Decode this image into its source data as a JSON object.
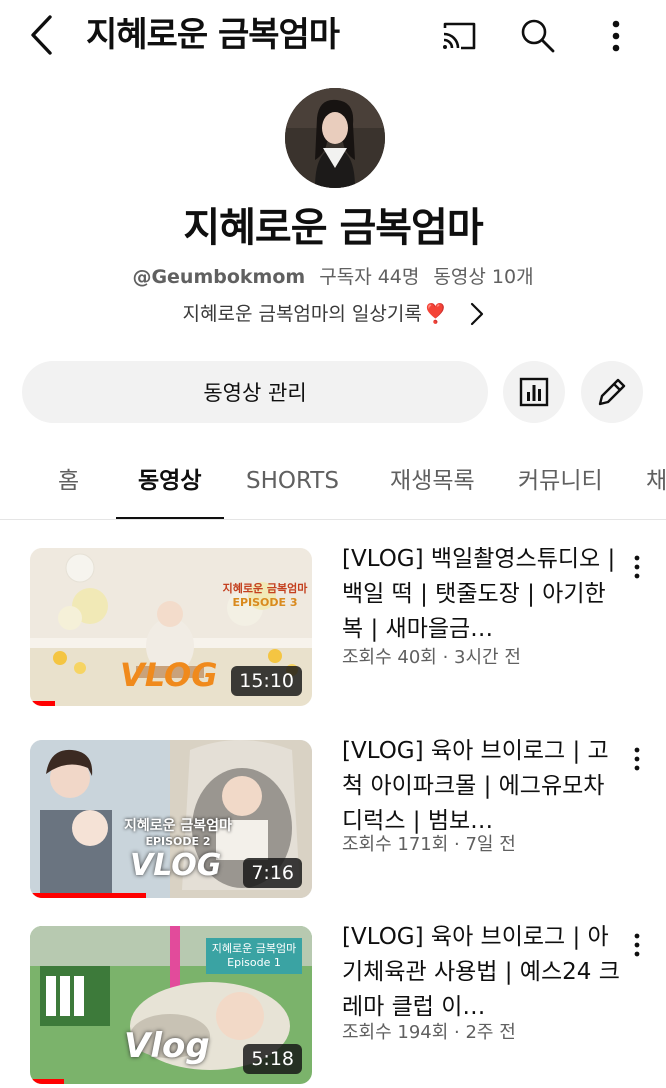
{
  "header": {
    "title": "지혜로운 금복엄마",
    "icons": [
      "back-arrow-icon",
      "cast-icon",
      "search-icon",
      "more-vert-icon"
    ]
  },
  "channel": {
    "name": "지혜로운 금복엄마",
    "handle": "@Geumbokmom",
    "subscribers": "구독자 44명",
    "video_count": "동영상 10개",
    "description": "지혜로운 금복엄마의 일상기록",
    "description_emoji": "❣️"
  },
  "actions": {
    "manage_label": "동영상 관리",
    "analytics_icon": "bar-chart-icon",
    "edit_icon": "pencil-icon"
  },
  "tabs": [
    "홈",
    "동영상",
    "SHORTS",
    "재생목록",
    "커뮤니티",
    "채"
  ],
  "active_tab": "동영상",
  "videos": [
    {
      "title": "[VLOG] 백일촬영스튜디오 | 백일 떡 | 탯줄도장 | 아기한복 | 새마을금…",
      "meta": "조회수 40회 · 3시간 전",
      "duration": "15:10",
      "progress": 0.09,
      "thumb_text": "지혜로운 금복엄마",
      "thumb_episode": "EPISODE 3",
      "thumb_vlog": "VLOG"
    },
    {
      "title": "[VLOG] 육아 브이로그 | 고척 아이파크몰 | 에그유모차 디럭스 | 범보…",
      "meta": "조회수 171회 · 7일 전",
      "duration": "7:16",
      "progress": 0.41,
      "thumb_text": "지혜로운 금복엄마",
      "thumb_episode": "EPISODE 2",
      "thumb_vlog": "VLOG"
    },
    {
      "title": "[VLOG] 육아 브이로그 | 아기체육관 사용법 | 예스24 크레마 클럽 이…",
      "meta": "조회수 194회 · 2주 전",
      "duration": "5:18",
      "progress": 0.12,
      "thumb_text": "지혜로운 금복엄마",
      "thumb_episode": "Episode 1",
      "thumb_vlog": "Vlog"
    }
  ],
  "colors": {
    "accent_red": "#ff0000",
    "text_primary": "#0f0f0f",
    "text_secondary": "#606060",
    "chip_bg": "#f2f2f2"
  }
}
